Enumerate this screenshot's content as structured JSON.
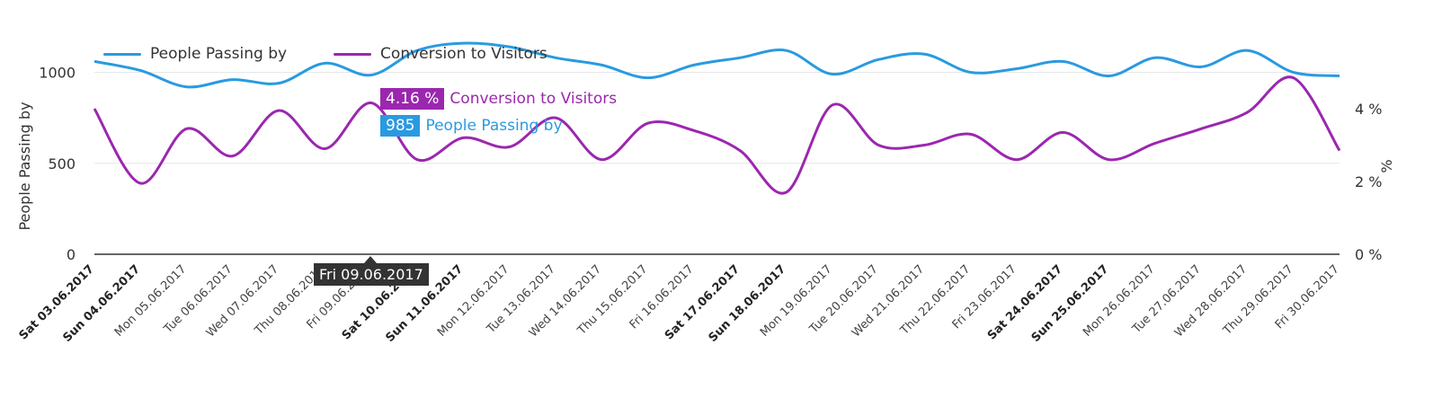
{
  "legend": {
    "series1": "People Passing by",
    "series2": "Conversion to Visitors"
  },
  "colors": {
    "visitors": "#2a9ae0",
    "conversion": "#9b27af",
    "axis": "#333333",
    "grid": "#e6e6e6"
  },
  "tooltip": {
    "date": "Fri 09.06.2017",
    "conversion_value": "4.16 %",
    "conversion_label": "Conversion to Visitors",
    "visitors_value": "985",
    "visitors_label": "People Passing by"
  },
  "chart_data": {
    "type": "line",
    "categories": [
      "Sat 03.06.2017",
      "Sun 04.06.2017",
      "Mon 05.06.2017",
      "Tue 06.06.2017",
      "Wed 07.06.2017",
      "Thu 08.06.2017",
      "Fri 09.06.2017",
      "Sat 10.06.2017",
      "Sun 11.06.2017",
      "Mon 12.06.2017",
      "Tue 13.06.2017",
      "Wed 14.06.2017",
      "Thu 15.06.2017",
      "Fri 16.06.2017",
      "Sat 17.06.2017",
      "Sun 18.06.2017",
      "Mon 19.06.2017",
      "Tue 20.06.2017",
      "Wed 21.06.2017",
      "Thu 22.06.2017",
      "Fri 23.06.2017",
      "Sat 24.06.2017",
      "Sun 25.06.2017",
      "Mon 26.06.2017",
      "Tue 27.06.2017",
      "Wed 28.06.2017",
      "Thu 29.06.2017",
      "Fri 30.06.2017"
    ],
    "bold_categories": [
      0,
      1,
      7,
      8,
      14,
      15,
      21,
      22
    ],
    "series": [
      {
        "name": "People Passing by",
        "axis": "left",
        "values": [
          1060,
          1010,
          920,
          960,
          940,
          1050,
          985,
          1120,
          1160,
          1140,
          1080,
          1040,
          970,
          1040,
          1080,
          1120,
          990,
          1070,
          1100,
          1000,
          1020,
          1060,
          980,
          1080,
          1030,
          1120,
          1000,
          980
        ]
      },
      {
        "name": "Conversion to Visitors",
        "axis": "right",
        "values": [
          4.0,
          1.95,
          3.45,
          2.7,
          3.95,
          2.9,
          4.16,
          2.6,
          3.2,
          2.95,
          3.75,
          2.6,
          3.6,
          3.4,
          2.85,
          1.7,
          4.1,
          3.0,
          3.0,
          3.3,
          2.6,
          3.35,
          2.6,
          3.05,
          3.45,
          3.9,
          4.85,
          2.85
        ]
      }
    ],
    "ylabel": "People Passing by",
    "ylim": [
      0,
      1200
    ],
    "yticks": [
      "0",
      "500",
      "1000"
    ],
    "yticks_values": [
      0,
      500,
      1000
    ],
    "y2label": "%",
    "y2lim": [
      0,
      6
    ],
    "y2ticks": [
      "0 %",
      "2 %",
      "4 %"
    ],
    "y2ticks_values": [
      0,
      2,
      4
    ],
    "grid": true,
    "legend_position": "top-left"
  }
}
